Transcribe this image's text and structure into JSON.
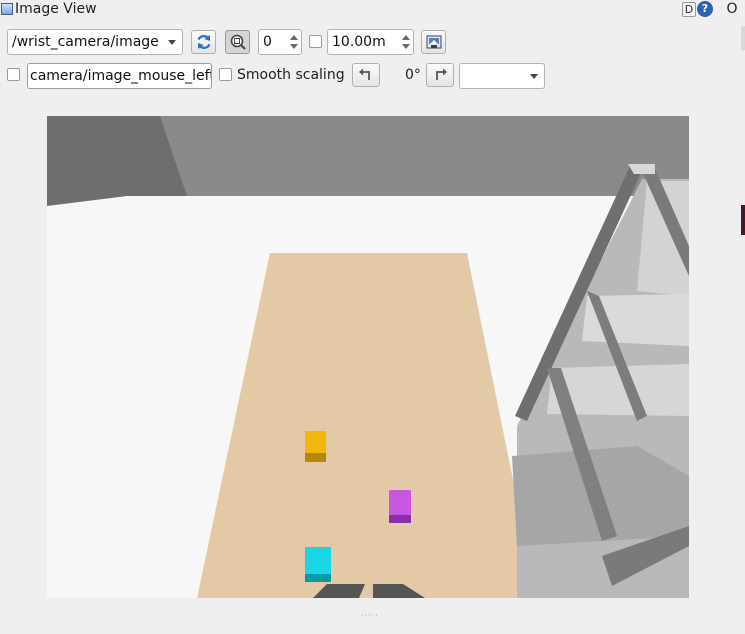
{
  "window": {
    "title": "Image View",
    "btn_d": "D",
    "btn_help": "?",
    "btn_o": "O"
  },
  "toolbar": {
    "topic": "/wrist_camera/image",
    "refresh_icon": "refresh-icon",
    "zoom_icon": "zoom-fit-icon",
    "spin_value": "0",
    "distance_value": "10.00m",
    "save_icon": "save-image-icon"
  },
  "row2": {
    "mouse_topic": "camera/image_mouse_left",
    "smooth_label": "Smooth scaling",
    "rotate_left_icon": "rotate-left-icon",
    "rotation_label": "0°",
    "rotate_right_icon": "rotate-right-icon",
    "color_scheme_value": ""
  },
  "scene": {
    "objects": [
      "yellow-cube",
      "magenta-cube",
      "cyan-cube"
    ],
    "colors": {
      "background_wall": "#8a8a8d",
      "floor": "#f7f7f7",
      "table": "#e3c9a5",
      "shelf_frame": "#6f6f72",
      "yellow_cube": "#f2b70f",
      "magenta_cube": "#c756e0",
      "cyan_cube": "#18d6e4",
      "gripper": "#555555"
    }
  }
}
